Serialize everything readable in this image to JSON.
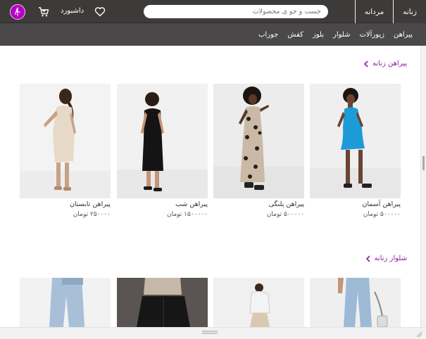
{
  "header": {
    "tabs": [
      {
        "label": "زنانه"
      },
      {
        "label": "مردانه"
      }
    ],
    "search": {
      "placeholder": "جست و جو ی محصولات"
    },
    "dashboard_label": "داشبورد"
  },
  "categories": [
    {
      "label": "پیراهن"
    },
    {
      "label": "زیورآلات"
    },
    {
      "label": "شلوار"
    },
    {
      "label": "بلوز"
    },
    {
      "label": "کفش"
    },
    {
      "label": "جوراب"
    }
  ],
  "sections": [
    {
      "title": "پیراهن زنانه",
      "products": [
        {
          "name": "پیراهن آسمان",
          "price": "۵۰۰۰۰۰ تومان"
        },
        {
          "name": "پیراهن پلنگی",
          "price": "۵۰۰۰۰۰ تومان"
        },
        {
          "name": "پیراهن شب",
          "price": "۱۵۰۰۰۰۰ تومان"
        },
        {
          "name": "پیراهن تابستان",
          "price": "۲۵۰۰۰۰ تومان"
        }
      ]
    },
    {
      "title": "شلوار زنانه"
    }
  ],
  "colors": {
    "topbar": "#3d3b3a",
    "categorybar": "#4a4848",
    "accent": "#8a1fa3",
    "logo": "#b800c4"
  },
  "icons": {
    "heart": "heart-icon",
    "cart": "cart-icon",
    "logo": "logo-icon",
    "chevron": "chevron-left-icon"
  }
}
